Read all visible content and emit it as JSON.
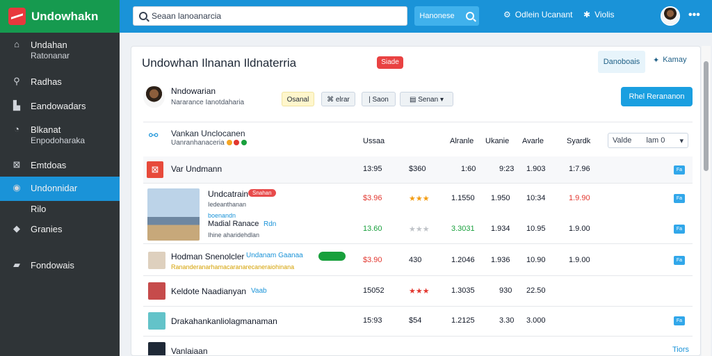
{
  "logo": {
    "title": "Undowhakn"
  },
  "topbar": {
    "search_placeholder": "Seaan lanoanarcia",
    "button_label": "Hanonese",
    "link1": "Odlein Ucanant",
    "link2": "Violis"
  },
  "sidebar": {
    "items": [
      {
        "label": "Undahan",
        "sub": "Ratonanar"
      },
      {
        "label": "Radhas"
      },
      {
        "label": "Eandowadars"
      },
      {
        "label": "Blkanat",
        "sub": "Enpodoharaka"
      },
      {
        "label": "Emtdoas"
      },
      {
        "label": "Undonnidar",
        "sub": "Rilo"
      },
      {
        "label": "Granies"
      },
      {
        "label": "Fondowais"
      }
    ]
  },
  "main": {
    "title": "Undowhan Ilnanan Ildnaterria",
    "badge": "Siade",
    "top_button": "Danoboais",
    "top_link": "Kamay",
    "user_name": "Nndowarian",
    "user_sub": "Nararance Ianotdaharia",
    "chips": [
      "Osanal",
      "elrar",
      "Saon",
      "Senan"
    ],
    "primary_button": "Rhel Rerananon",
    "header_title": "Vankan Unclocanen",
    "header_meta": "Uanranhanaceria",
    "header_columns": [
      "Ussaa",
      "Alranle",
      "Ukanie",
      "Avarle",
      "Syardk"
    ],
    "select_label": "Valde",
    "select_value": "lam 0",
    "rows": [
      {
        "title": "Var Undmann",
        "c1": "13:95",
        "c2": "$360",
        "c3": "1:60",
        "c4": "9:23",
        "c5": "1.903",
        "c6": "1:7.96"
      },
      {
        "title": "Undcatrain",
        "tag": "Snahan",
        "sub": "Iedeanthanan",
        "sub2": "boenandn",
        "c1": "$3.96",
        "stars": "★★★",
        "c3": "1.1550",
        "c4": "1.950",
        "c5": "10:34",
        "c6": "1.9.90"
      },
      {
        "title": "Madial Ranace",
        "tag": "Rdn",
        "sub": "Ihine aharidehdlan",
        "c1": "13.60",
        "stars": "★★★",
        "c3": "3.3031",
        "c4": "1.934",
        "c5": "10.95",
        "c6": "1.9.00"
      },
      {
        "title": "Hodman Snenolcler",
        "tag": "Undanam Gaanaa",
        "sub": "Rananderanarhamacaranarecaneraiohinana",
        "c1": "$3.90",
        "c2": "430",
        "c3": "1.2046",
        "c4": "1.936",
        "c5": "10.90",
        "c6": "1.9.00"
      },
      {
        "title": "Keldote Naadianyan",
        "tag": "Vaab",
        "c1": "15052",
        "stars": "★★★",
        "c3": "1.3035",
        "c4": "930",
        "c5": "22.50"
      },
      {
        "title": "Drakahankanliolagmanaman",
        "c1": "15:93",
        "c2": "$54",
        "c3": "1.2125",
        "c4": "3.30",
        "c5": "3.000"
      },
      {
        "title": "Vanlaiaan",
        "action": "Tiors"
      }
    ]
  }
}
